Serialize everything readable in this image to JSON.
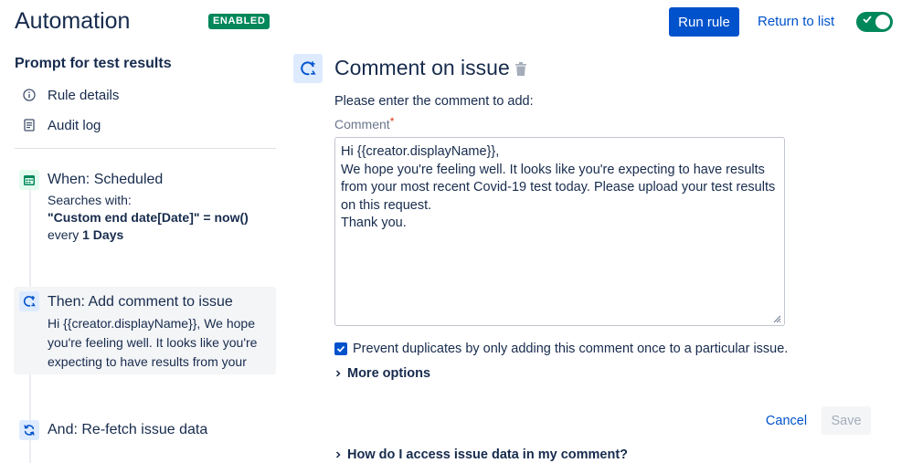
{
  "header": {
    "title": "Automation",
    "badge": "ENABLED",
    "run_rule_label": "Run rule",
    "return_label": "Return to list",
    "toggle_on": true
  },
  "sidebar": {
    "rule_name": "Prompt for test results",
    "nav": [
      {
        "label": "Rule details",
        "icon": "info-icon"
      },
      {
        "label": "Audit log",
        "icon": "document-icon"
      }
    ],
    "steps": {
      "when": {
        "title": "When: Scheduled",
        "line1": "Searches with:",
        "line2": "\"Custom end date[Date]\" = now()",
        "line3_prefix": "every",
        "line3_value": "1 Days",
        "icon": "calendar-icon"
      },
      "then": {
        "title": "Then: Add comment to issue",
        "preview_lines": [
          "Hi {{creator.displayName}}, We hope",
          "you're feeling well. It looks like you're",
          "expecting to have results from your"
        ],
        "icon": "comment-add-icon"
      },
      "and": {
        "title": "And: Re-fetch issue data",
        "icon": "refresh-icon"
      }
    }
  },
  "main": {
    "title": "Comment on issue",
    "instruction": "Please enter the comment to add:",
    "comment_label": "Comment",
    "required_marker": "*",
    "comment_value": "Hi {{creator.displayName}},\nWe hope you're feeling well. It looks like you're expecting to have results\nfrom your most recent Covid-19 test today. Please upload your test results\non this request.\nThank you.",
    "prevent_duplicates_label": "Prevent duplicates by only adding this comment once to a particular issue.",
    "prevent_duplicates_checked": true,
    "more_options_label": "More options",
    "cancel_label": "Cancel",
    "save_label": "Save",
    "help_label": "How do I access issue data in my comment?"
  },
  "colors": {
    "primary": "#0052cc",
    "success": "#00875a",
    "text": "#172b4d",
    "subtle": "#6b778c",
    "panel": "#f4f5f7",
    "icon_bg": "#deebff"
  }
}
